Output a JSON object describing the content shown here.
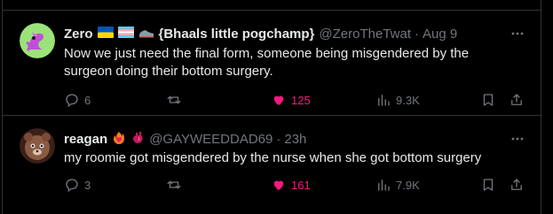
{
  "tweets": [
    {
      "display_name": "Zero",
      "name_suffix": "{Bhaals little pogchamp}",
      "handle": "@ZeroTheTwat",
      "separator": "·",
      "time": "Aug 9",
      "text": "Now we just need the final form, someone being misgendered by the surgeon doing their bottom surgery.",
      "replies": "6",
      "retweets": "",
      "likes": "125",
      "views": "9.3K",
      "liked": true,
      "avatar_bg": "#9be27a",
      "emoji_names": [
        "ukraine-flag-icon",
        "trans-flag-icon",
        "sneaker-icon"
      ]
    },
    {
      "display_name": "reagan",
      "name_suffix": "",
      "handle": "@GAYWEEDDAD69",
      "separator": "·",
      "time": "23h",
      "text": "my roomie got misgendered by the nurse when she got bottom surgery",
      "replies": "3",
      "retweets": "",
      "likes": "161",
      "views": "7.9K",
      "liked": true,
      "avatar_bg": "#6b3b2e",
      "emoji_names": [
        "heart-on-fire-icon",
        "anatomical-heart-icon"
      ]
    }
  ],
  "colors": {
    "background": "#000000",
    "text": "#e7e9ea",
    "muted": "#71767b",
    "like": "#f91880",
    "border": "#2f3336"
  }
}
